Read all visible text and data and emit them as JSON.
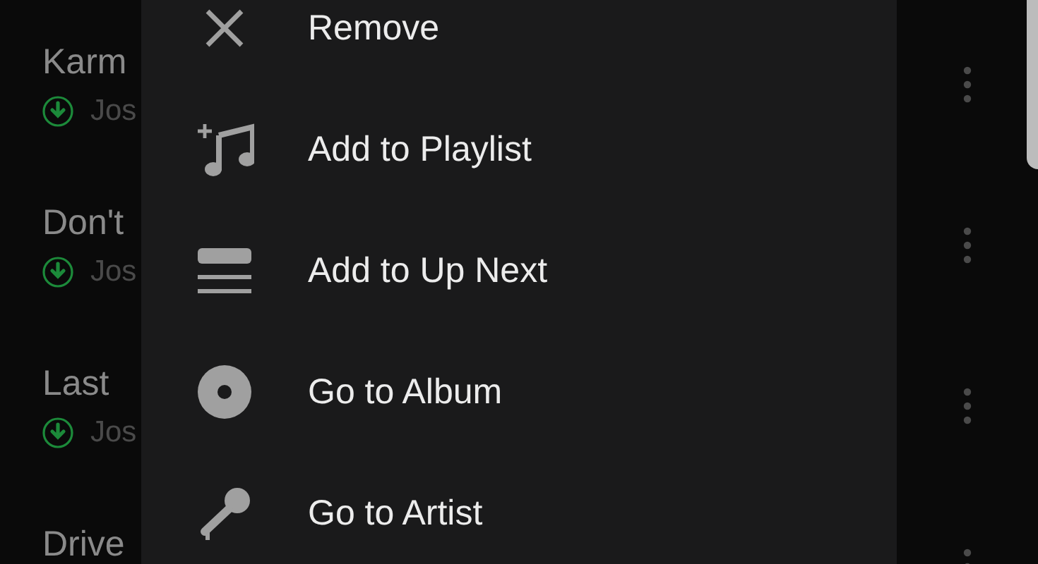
{
  "tracks": [
    {
      "title": "Karm",
      "artist": "Jos",
      "downloaded": true
    },
    {
      "title": "Don't",
      "artist": "Jos",
      "downloaded": true
    },
    {
      "title": "Last",
      "artist": "Jos",
      "downloaded": true
    },
    {
      "title": "Drive"
    }
  ],
  "menu": {
    "items": [
      {
        "kind": "remove",
        "label": "Remove"
      },
      {
        "kind": "playlist",
        "label": "Add to Playlist"
      },
      {
        "kind": "queue",
        "label": "Add to Up Next"
      },
      {
        "kind": "album",
        "label": "Go to Album"
      },
      {
        "kind": "artist",
        "label": "Go to Artist"
      }
    ]
  }
}
